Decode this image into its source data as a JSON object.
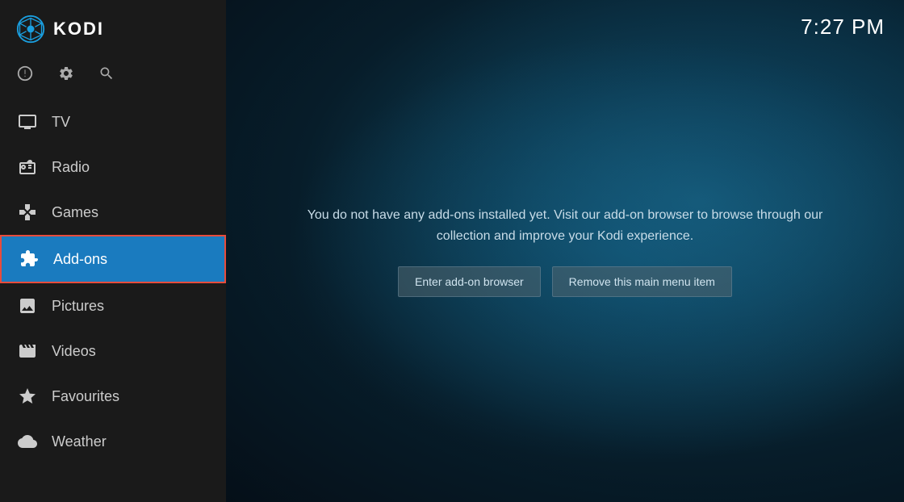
{
  "app": {
    "title": "KODI",
    "clock": "7:27 PM"
  },
  "sidebar": {
    "icons": [
      {
        "name": "power-icon",
        "symbol": "⏻"
      },
      {
        "name": "settings-icon",
        "symbol": "⚙"
      },
      {
        "name": "search-icon",
        "symbol": "🔍"
      }
    ],
    "nav_items": [
      {
        "id": "tv",
        "label": "TV",
        "icon": "tv-icon",
        "active": false
      },
      {
        "id": "radio",
        "label": "Radio",
        "icon": "radio-icon",
        "active": false
      },
      {
        "id": "games",
        "label": "Games",
        "icon": "games-icon",
        "active": false
      },
      {
        "id": "addons",
        "label": "Add-ons",
        "icon": "addons-icon",
        "active": true
      },
      {
        "id": "pictures",
        "label": "Pictures",
        "icon": "pictures-icon",
        "active": false
      },
      {
        "id": "videos",
        "label": "Videos",
        "icon": "videos-icon",
        "active": false
      },
      {
        "id": "favourites",
        "label": "Favourites",
        "icon": "favourites-icon",
        "active": false
      },
      {
        "id": "weather",
        "label": "Weather",
        "icon": "weather-icon",
        "active": false
      }
    ]
  },
  "main": {
    "description": "You do not have any add-ons installed yet. Visit our add-on browser to browse through our collection and improve your Kodi experience.",
    "buttons": [
      {
        "id": "enter-addon-browser",
        "label": "Enter add-on browser"
      },
      {
        "id": "remove-main-menu-item",
        "label": "Remove this main menu item"
      }
    ]
  }
}
